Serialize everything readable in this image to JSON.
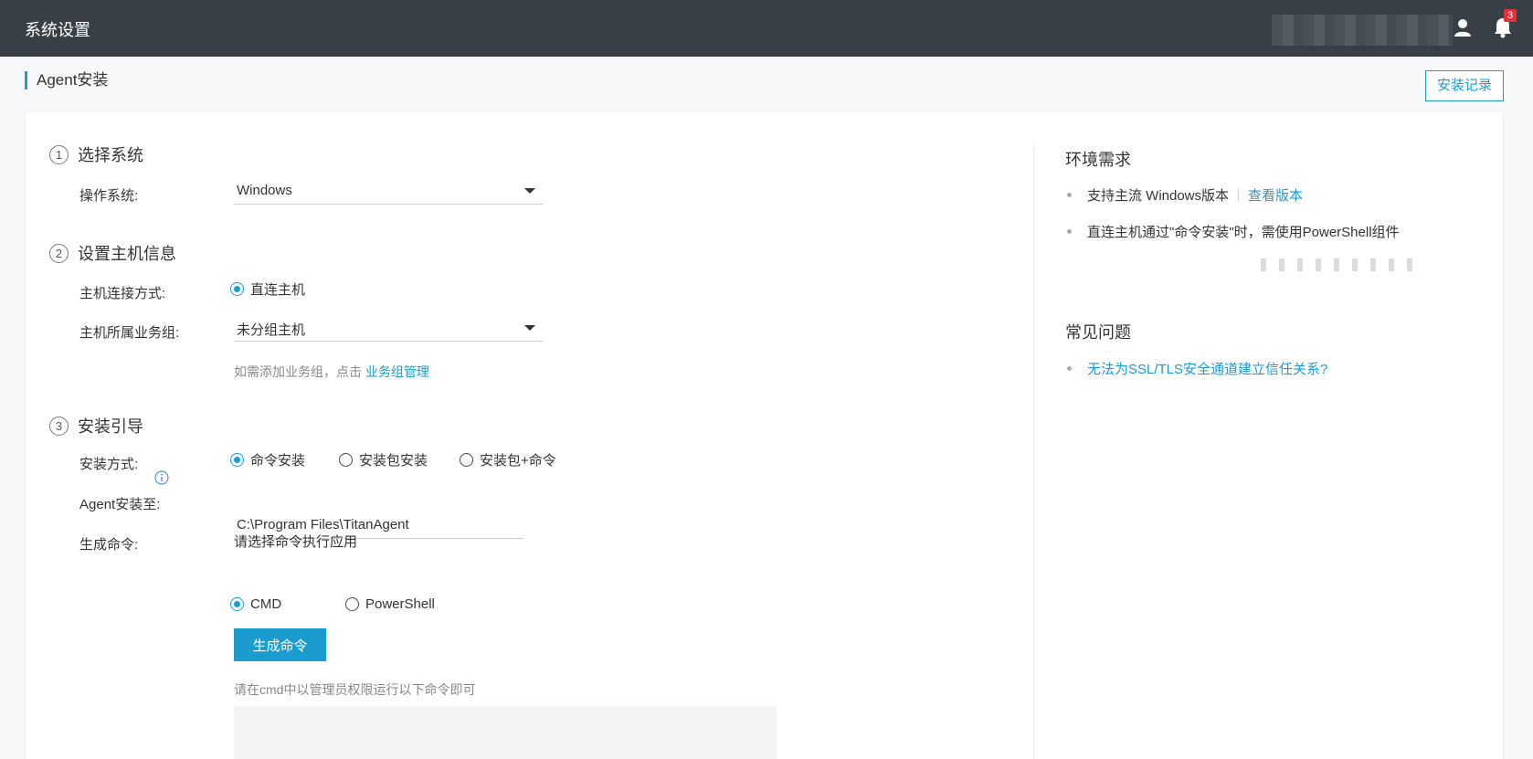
{
  "topbar": {
    "title": "系统设置",
    "notification_count": "3"
  },
  "page": {
    "title": "Agent安装",
    "history_button": "安装记录"
  },
  "step1": {
    "number": "①",
    "title": "选择系统",
    "os_label": "操作系统:",
    "os_value": "Windows"
  },
  "step2": {
    "number": "②",
    "title": "设置主机信息",
    "connect_label": "主机连接方式:",
    "connect_option": "直连主机",
    "group_label": "主机所属业务组:",
    "group_value": "未分组主机",
    "group_hint": "如需添加业务组，点击",
    "group_link": "业务组管理"
  },
  "step3": {
    "number": "③",
    "title": "安装引导",
    "method_label": "安装方式:",
    "methods": [
      "命令安装",
      "安装包安装",
      "安装包+命令"
    ],
    "path_label": "Agent安装至:",
    "path_value": "C:\\Program Files\\TitanAgent",
    "command_label": "生成命令:",
    "command_hint": "请选择命令执行应用",
    "apps": [
      "CMD",
      "PowerShell"
    ],
    "generate_button": "生成命令",
    "run_hint": "请在cmd中以管理员权限运行以下命令即可"
  },
  "env": {
    "title": "环境需求",
    "item1": "支持主流 Windows版本",
    "item1_link": "查看版本",
    "item2": "直连主机通过\"命令安装\"时，需使用PowerShell组件"
  },
  "faq": {
    "title": "常见问题",
    "item1": "无法为SSL/TLS安全通道建立信任关系?"
  },
  "colors": {
    "accent": "#1a9ccf",
    "topbar": "#393f46",
    "badge": "#e0313a"
  }
}
